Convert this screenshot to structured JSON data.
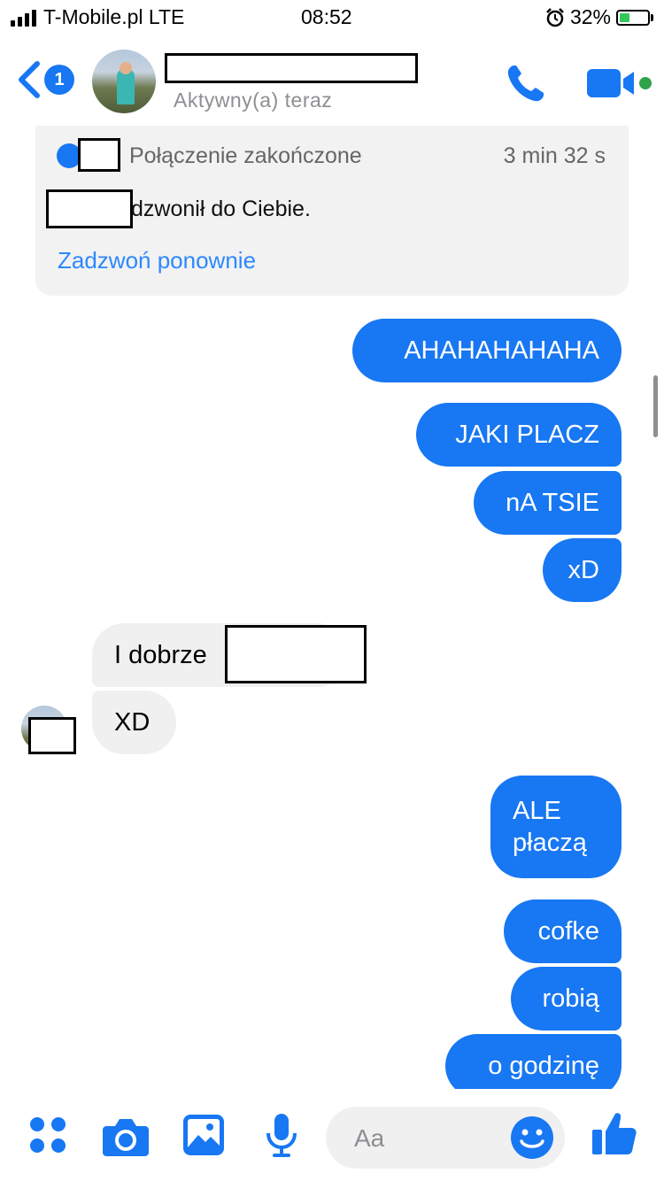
{
  "status_bar": {
    "carrier": "T-Mobile.pl LTE",
    "time": "08:52",
    "battery_percent": "32%",
    "battery_level": 0.32,
    "icons": [
      "signal-icon",
      "alarm-icon",
      "battery-charging-icon"
    ]
  },
  "header": {
    "back_badge": "1",
    "active_status": "Aktywny(a) teraz",
    "icons": [
      "back-chevron-icon",
      "phone-icon",
      "video-camera-icon"
    ]
  },
  "call_card": {
    "title": "Połączenie zakończone",
    "duration": "3 min 32 s",
    "description": "dzwonił do Ciebie.",
    "call_again": "Zadzwoń ponownie"
  },
  "messages": [
    {
      "side": "out",
      "text": "AHAHAHAHAHA"
    },
    {
      "side": "out",
      "text": "JAKI PLACZ"
    },
    {
      "side": "out",
      "text": "nA TSIE"
    },
    {
      "side": "out",
      "text": "xD"
    },
    {
      "side": "in",
      "text": "I dobrze"
    },
    {
      "side": "in",
      "text": "XD"
    },
    {
      "side": "out",
      "lines": [
        "ALE",
        "płaczą"
      ]
    },
    {
      "side": "out",
      "text": "cofke"
    },
    {
      "side": "out",
      "text": "robią"
    },
    {
      "side": "out",
      "text": "o godzinę"
    }
  ],
  "composer": {
    "placeholder": "Aa",
    "icons": [
      "apps-icon",
      "camera-icon",
      "gallery-icon",
      "microphone-icon",
      "emoji-icon",
      "thumbs-up-icon"
    ]
  },
  "colors": {
    "accent": "#1877f2",
    "incoming_bubble": "#f0f0f0",
    "link": "#2d88ff",
    "online": "#31a24c"
  }
}
